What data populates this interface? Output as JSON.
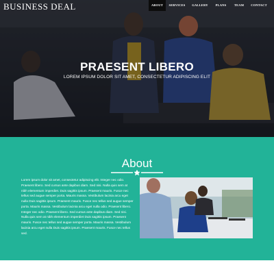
{
  "brand": "BUSINESS DEAL",
  "nav": {
    "items": [
      {
        "label": "ABOUT"
      },
      {
        "label": "SERVICES"
      },
      {
        "label": "GALLERY"
      },
      {
        "label": "PLANS"
      },
      {
        "label": "TEAM"
      },
      {
        "label": "CONTACT"
      }
    ],
    "active_index": 0
  },
  "hero": {
    "title": "PRAESENT LIBERO",
    "subtitle": "LOREM IPSUM DOLOR SIT AMET, CONSECTETUR ADIPISCING ELIT"
  },
  "about": {
    "title": "About",
    "text": "Lorem ipsum dolor sit amet, consectetur adipiscing elit. Integer nec odio. Praesent libero. Sed cursus ante dapibus diam. Sed nisi. Nulla quis sem at nibh elementum imperdiet. Duis sagittis ipsum. Praesent mauris. Fusce nec tellus sed augue semper porta. Mauris massa. Vestibulum lacinia arcu eget nulla Duis sagittis ipsum. Praesent mauris. Fusce nec tellus sed augue semper porta. Mauris massa. Vestibulum lacinia arcu eget nulla odio. Praesent libero. Integer nec odio. Praesent libero. Sed cursus ante dapibus diam. Sed nisi. Nulla quis sem at nibh elementum imperdiet Duis sagittis ipsum. Praesent mauris. Fusce nec tellus sed augue semper porta. Mauris massa. Vestibulum lacinia arcu eget nulla Duis sagittis ipsum. Praesent mauris. Fusce nec tellus sed."
  },
  "colors": {
    "accent": "#22b398",
    "nav_active": "#0c0c0c",
    "hero_overlay": "#1b1e25"
  },
  "icons": [
    "star-icon"
  ]
}
